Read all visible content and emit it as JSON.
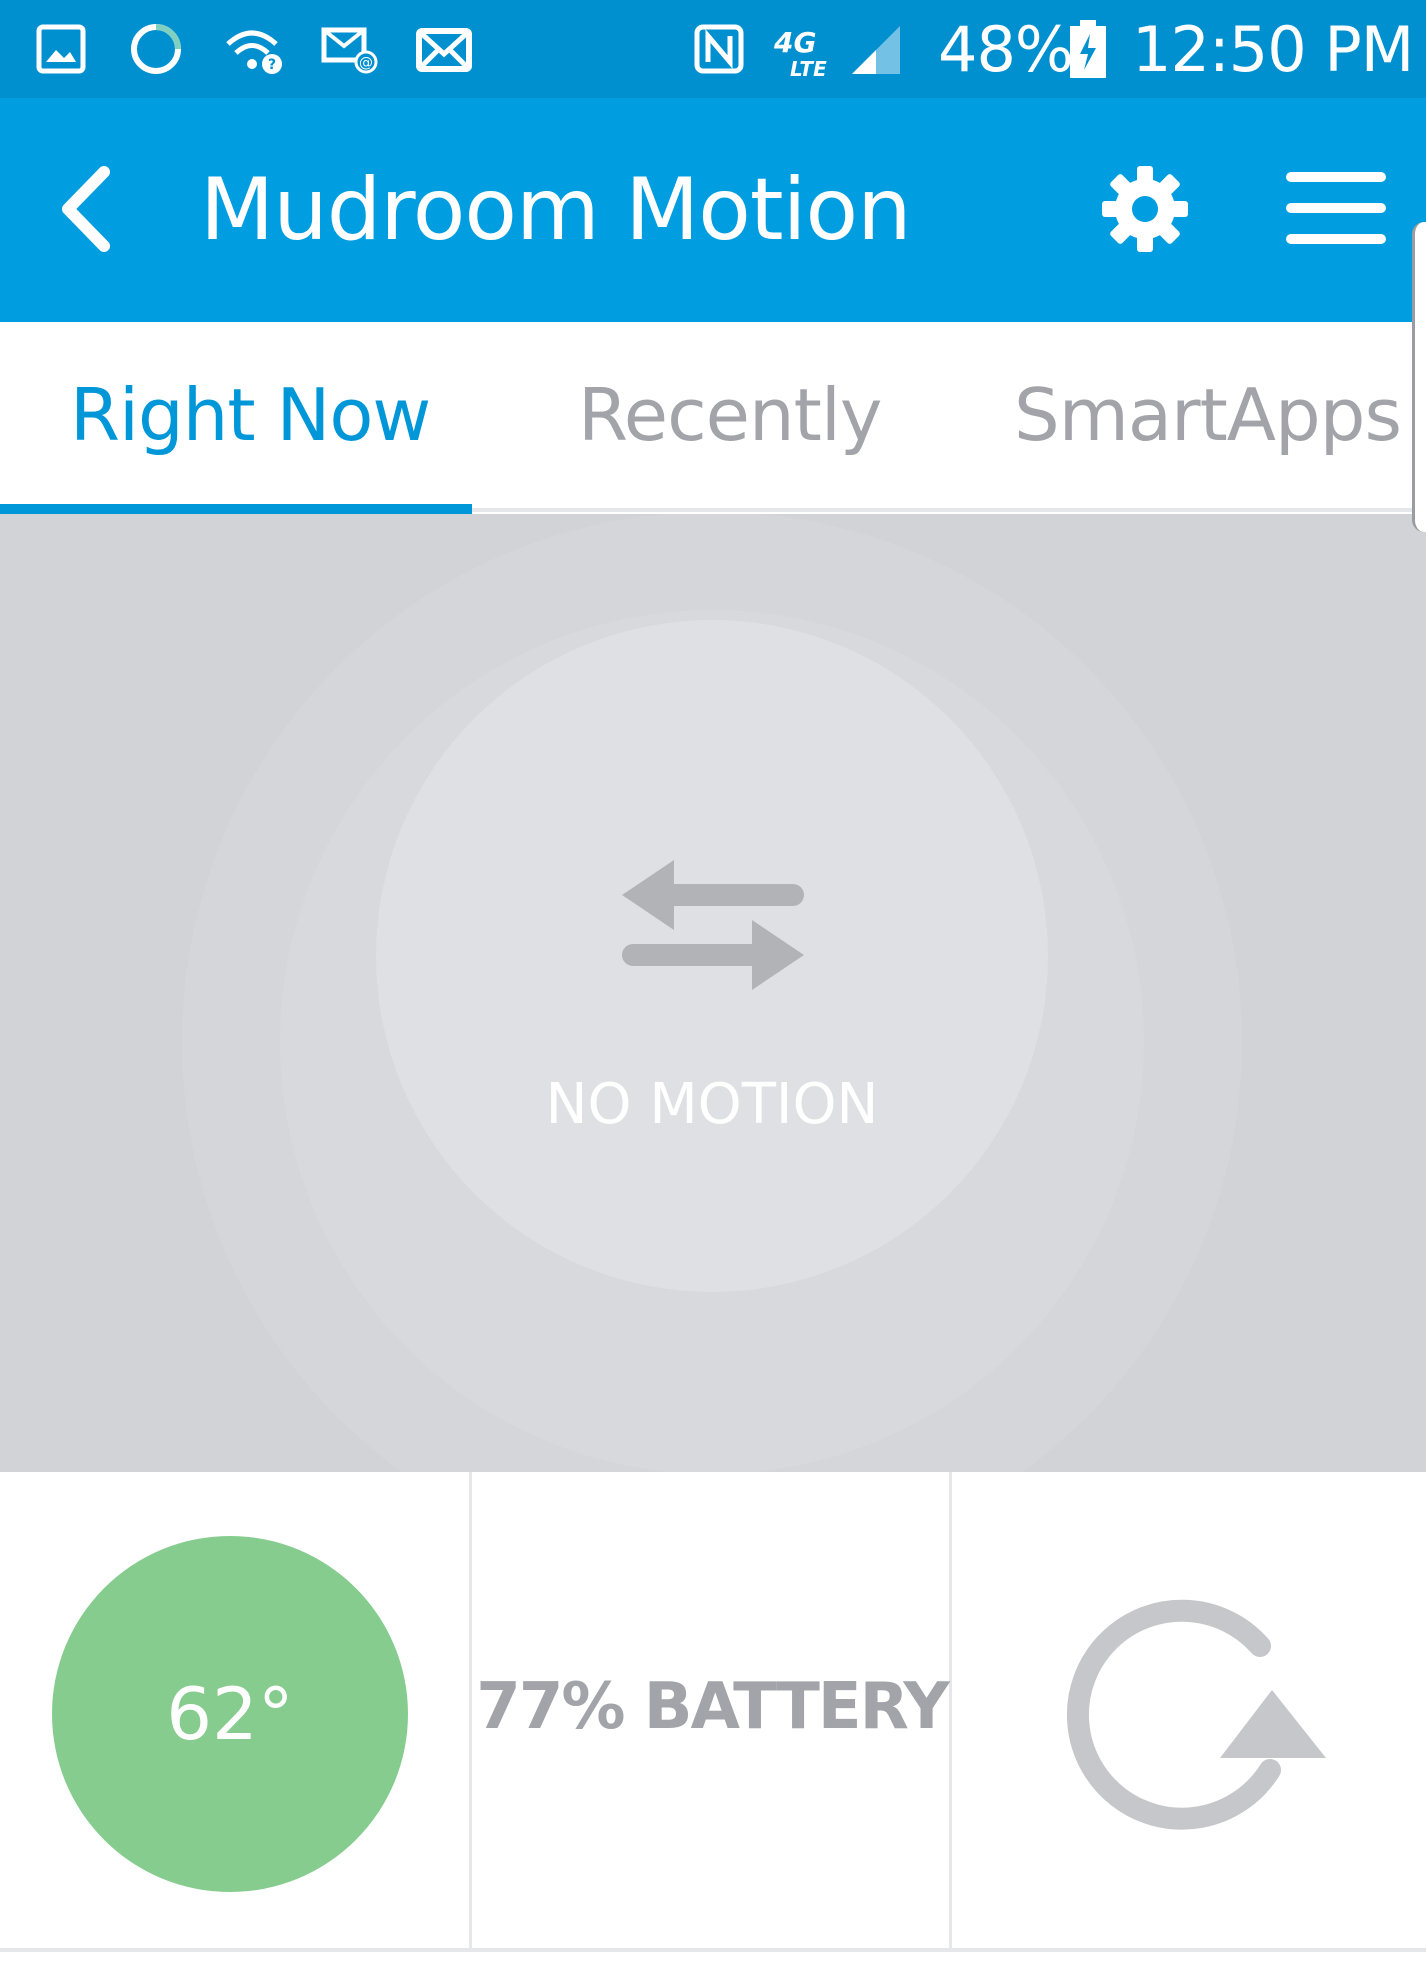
{
  "status_bar": {
    "battery_percent": "48%",
    "time": "12:50 PM",
    "network": "4G LTE",
    "icons": [
      "gallery-icon",
      "circle-app-icon",
      "wifi-question-icon",
      "email-at-icon",
      "mail-icon",
      "nfc-icon",
      "lte-icon",
      "signal-icon",
      "battery-charging-icon"
    ]
  },
  "app_bar": {
    "title": "Mudroom Motion",
    "back_icon": "chevron-left-icon",
    "settings_icon": "gear-icon",
    "menu_icon": "hamburger-icon"
  },
  "tabs": [
    {
      "label": "Right Now",
      "active": true
    },
    {
      "label": "Recently",
      "active": false
    },
    {
      "label": "SmartApps",
      "active": false
    }
  ],
  "hero": {
    "status_label": "NO MOTION",
    "icon": "swap-arrows-icon"
  },
  "tiles": {
    "temperature": "62°",
    "battery": "77% BATTERY",
    "refresh_icon": "refresh-icon"
  },
  "colors": {
    "status_bar": "#0090cf",
    "app_bar": "#009ee0",
    "accent": "#0097d9",
    "hero_bg": "#d2d3d7",
    "temperature_tile": "#85cc8e",
    "muted_text": "#a2a4a9"
  }
}
